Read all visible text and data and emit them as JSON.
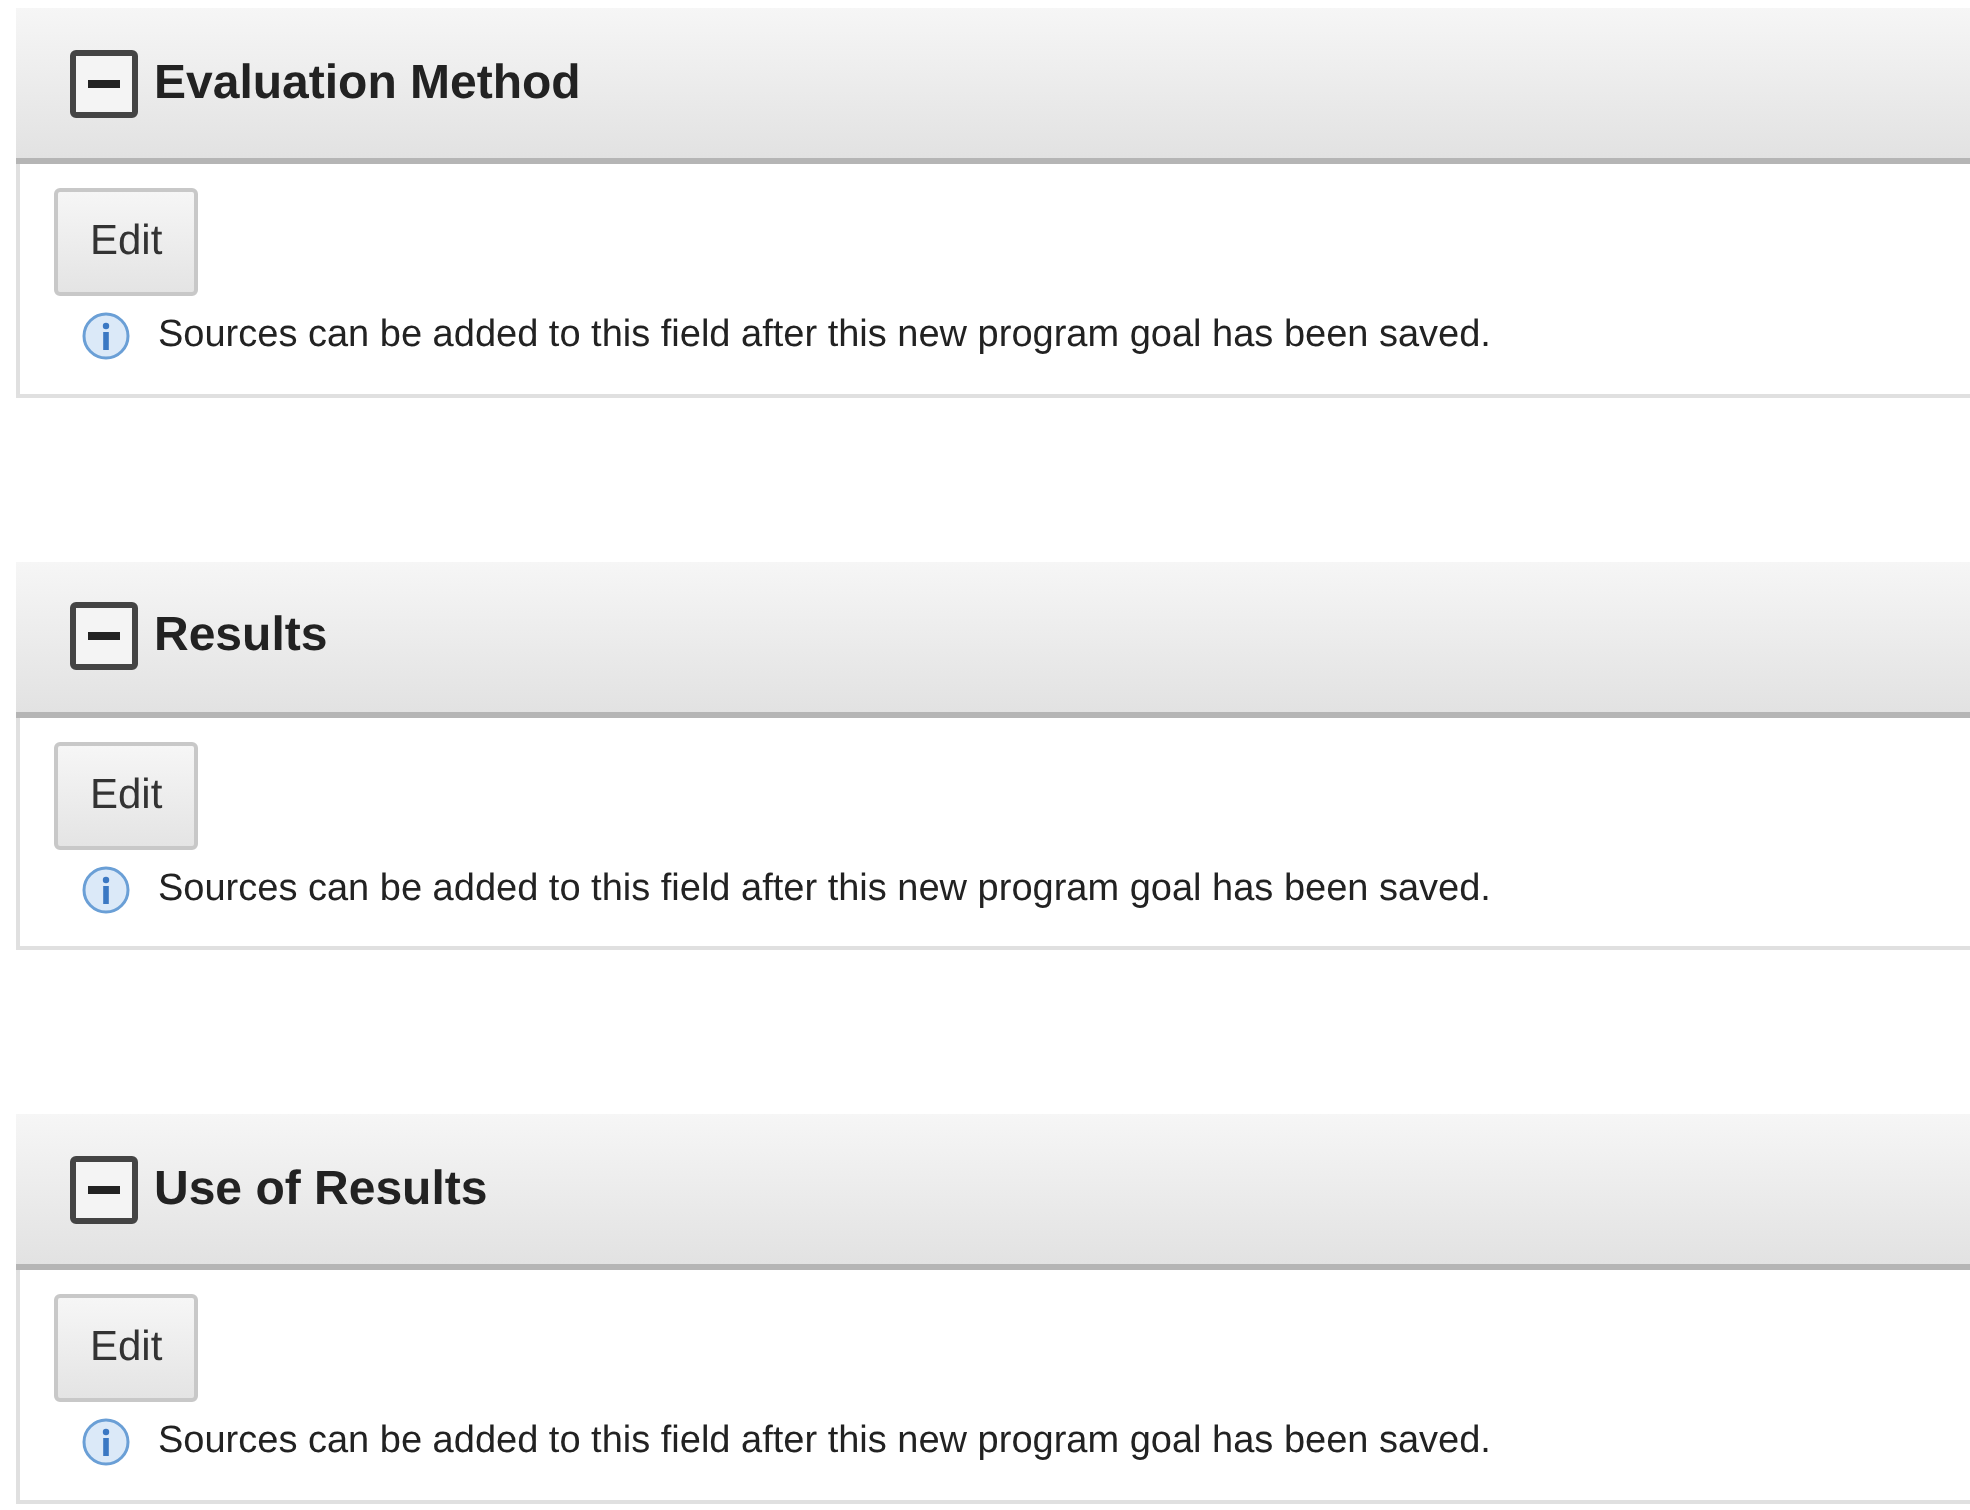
{
  "sections": [
    {
      "title": "Evaluation Method",
      "expanded": true,
      "button": "Edit",
      "note": "Sources can be added to this field after this new program goal has been saved."
    },
    {
      "title": "Results",
      "expanded": true,
      "button": "Edit",
      "note": "Sources can be added to this field after this new program goal has been saved."
    },
    {
      "title": "Use of Results",
      "expanded": true,
      "button": "Edit",
      "note": "Sources can be added to this field after this new program goal has been saved."
    }
  ]
}
